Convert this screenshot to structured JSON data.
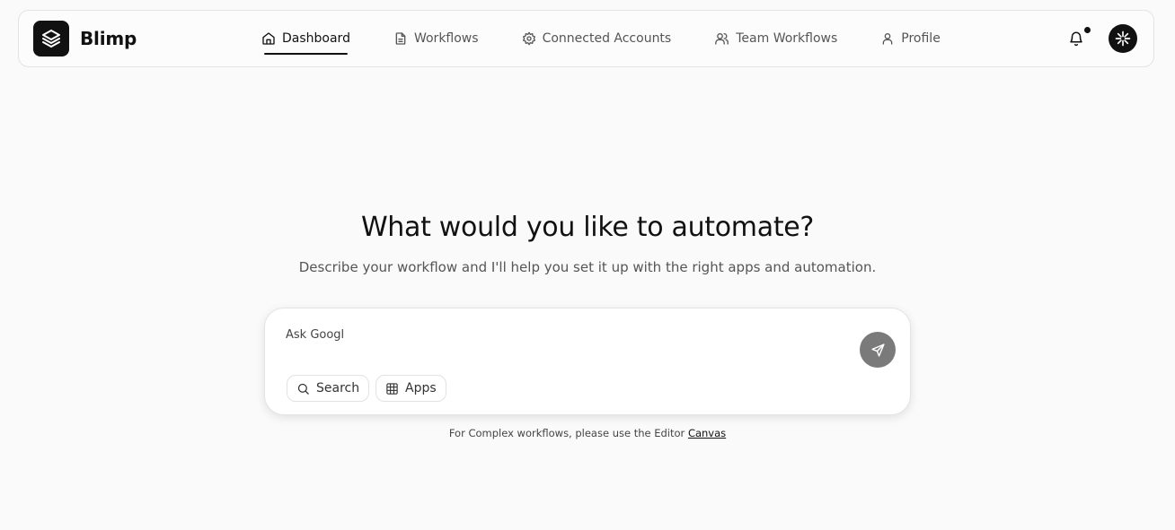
{
  "app": {
    "brand": "Blimp"
  },
  "nav": {
    "items": [
      {
        "label": "Dashboard",
        "icon": "home-icon",
        "active": true
      },
      {
        "label": "Workflows",
        "icon": "document-icon",
        "active": false
      },
      {
        "label": "Connected Accounts",
        "icon": "gear-icon",
        "active": false
      },
      {
        "label": "Team Workflows",
        "icon": "users-icon",
        "active": false
      },
      {
        "label": "Profile",
        "icon": "user-icon",
        "active": false
      }
    ]
  },
  "header": {
    "notification_icon": "bell-icon",
    "has_unread": true,
    "avatar_icon": "asterisk-icon"
  },
  "main": {
    "title": "What would you like to automate?",
    "subtitle": "Describe your workflow and I'll help you set it up with the right apps and automation."
  },
  "prompt": {
    "value": "Ask Googl",
    "send_icon": "send-icon",
    "chips": [
      {
        "label": "Search",
        "icon": "search-icon"
      },
      {
        "label": "Apps",
        "icon": "grid-icon"
      }
    ]
  },
  "footer": {
    "note": "For Complex workflows, please use the Editor ",
    "link": "Canvas"
  },
  "colors": {
    "background": "#fafafa",
    "accent": "#111111",
    "send_button": "#7a7a7a"
  }
}
